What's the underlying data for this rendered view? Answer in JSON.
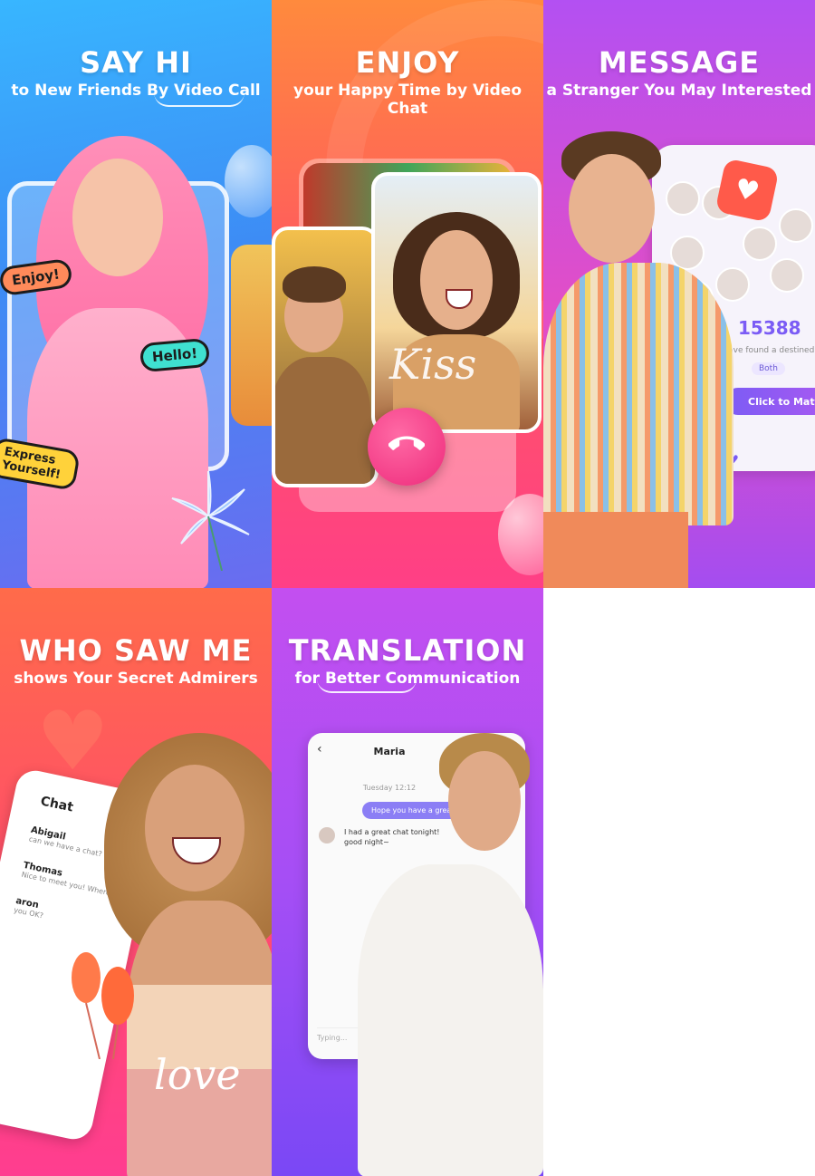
{
  "panels": [
    {
      "title": "SAY HI",
      "subtitle": "to New Friends By Video Call",
      "stickers": [
        "Enjoy!",
        "Hello!",
        "Express Yourself!"
      ]
    },
    {
      "title": "ENJOY",
      "subtitle": "your Happy Time by Video Chat",
      "overlay_text": "Kiss"
    },
    {
      "title": "MESSAGE",
      "subtitle": "a Stranger You May Interested",
      "match_count": "15388",
      "match_desc": "e have found a destined pers",
      "both_label": "Both",
      "match_button": "Click to Match"
    },
    {
      "title": "WHO SAW ME",
      "subtitle": "shows Your Secret Admirers",
      "chat_title": "Chat",
      "chats": [
        {
          "name": "Abigail",
          "msg": "can we have a chat?"
        },
        {
          "name": "Thomas",
          "msg": "Nice to meet you! Where you ar"
        },
        {
          "name": "aron",
          "msg": "you OK?"
        }
      ],
      "overlay_text": "love"
    },
    {
      "title": "TRANSLATION",
      "subtitle": "for Better Communication",
      "conv_name": "Maria",
      "conv_date": "Tuesday 12:12",
      "msg_out": "Hope you have a great d",
      "msg_in": "I had a great chat tonight! good night~",
      "input_placeholder": "Typing..."
    }
  ],
  "colors": {
    "p1": "#3d8cf5",
    "p2": "#ff5a5e",
    "p3": "#b350f2",
    "p4": "#ff4e6a",
    "p5": "#a54ef5",
    "call_button": "#ee2a7b",
    "match_accent": "#7b5cf5"
  },
  "icons": [
    "phone-icon",
    "heart-icon",
    "back-chevron-icon"
  ]
}
